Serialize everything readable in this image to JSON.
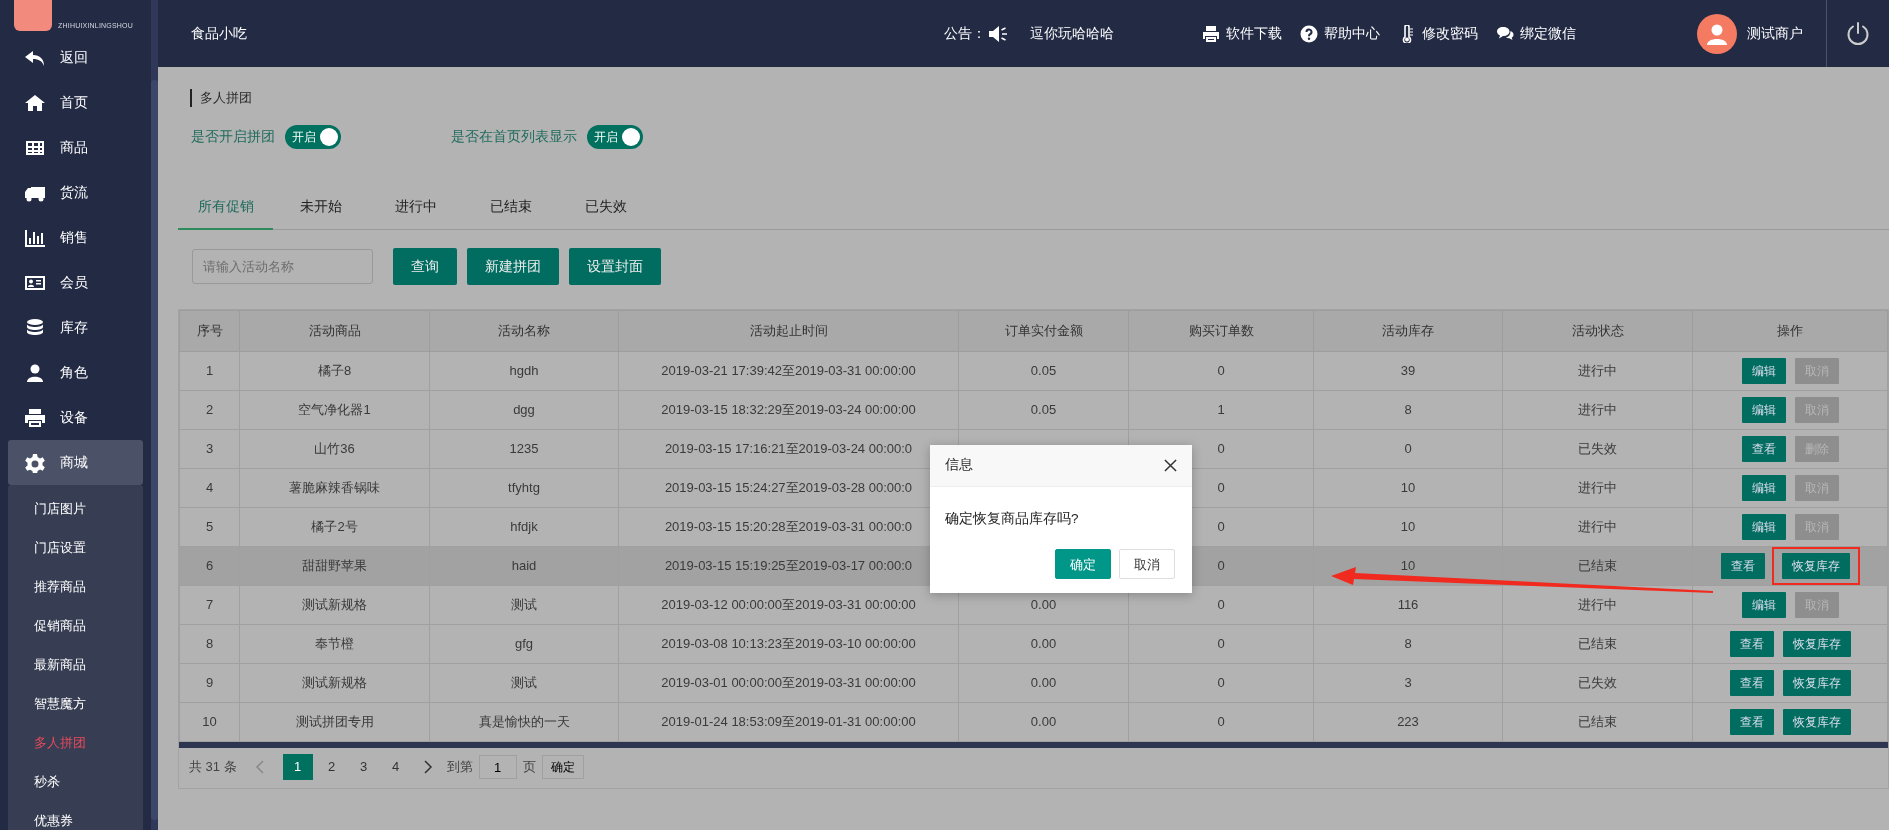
{
  "header": {
    "shop_name": "食品小吃",
    "notice_label": "公告：",
    "notice_text": "逗你玩哈哈哈",
    "links": [
      "软件下载",
      "帮助中心",
      "修改密码",
      "绑定微信"
    ],
    "user_name": "测试商户"
  },
  "sidebar": {
    "logo_text": "ZHIHUIXINLINGSHOU",
    "items": [
      {
        "label": "返回",
        "selected": false
      },
      {
        "label": "首页",
        "selected": false
      },
      {
        "label": "商品",
        "selected": false
      },
      {
        "label": "货流",
        "selected": false
      },
      {
        "label": "销售",
        "selected": false
      },
      {
        "label": "会员",
        "selected": false
      },
      {
        "label": "库存",
        "selected": false
      },
      {
        "label": "角色",
        "selected": false
      },
      {
        "label": "设备",
        "selected": false
      },
      {
        "label": "商城",
        "selected": true,
        "expanded": true,
        "children": [
          {
            "label": "门店图片",
            "selected": false
          },
          {
            "label": "门店设置",
            "selected": false
          },
          {
            "label": "推荐商品",
            "selected": false
          },
          {
            "label": "促销商品",
            "selected": false
          },
          {
            "label": "最新商品",
            "selected": false
          },
          {
            "label": "智慧魔方",
            "selected": false
          },
          {
            "label": "多人拼团",
            "selected": true
          },
          {
            "label": "秒杀",
            "selected": false
          },
          {
            "label": "优惠券",
            "selected": false
          }
        ]
      }
    ]
  },
  "page_title": "多人拼团",
  "toggles": [
    {
      "label": "是否开启拼团",
      "on": true,
      "state_text": "开启"
    },
    {
      "label": "是否在首页列表显示",
      "on": true,
      "state_text": "开启"
    }
  ],
  "tabs": [
    {
      "label": "所有促销",
      "selected": true
    },
    {
      "label": "未开始",
      "selected": false
    },
    {
      "label": "进行中",
      "selected": false
    },
    {
      "label": "已结束",
      "selected": false
    },
    {
      "label": "已失效",
      "selected": false
    }
  ],
  "search": {
    "placeholder": "请输入活动名称"
  },
  "buttons": [
    "查询",
    "新建拼团",
    "设置封面"
  ],
  "table": {
    "columns": [
      "序号",
      "活动商品",
      "活动名称",
      "活动起止时间",
      "订单实付金额",
      "购买订单数",
      "活动库存",
      "活动状态",
      "操作"
    ],
    "rows": [
      {
        "hovered": false,
        "cells": [
          "1",
          "橘子8",
          "hgdh",
          "2019-03-21 17:39:42至2019-03-31 00:00:00",
          "0.05",
          "0",
          "39",
          "进行中"
        ],
        "actions": [
          {
            "label": "编辑",
            "disabled": false
          },
          {
            "label": "取消",
            "disabled": true
          }
        ]
      },
      {
        "hovered": false,
        "cells": [
          "2",
          "空气净化器1",
          "dgg",
          "2019-03-15 18:32:29至2019-03-24 00:00:00",
          "0.05",
          "1",
          "8",
          "进行中"
        ],
        "actions": [
          {
            "label": "编辑",
            "disabled": false
          },
          {
            "label": "取消",
            "disabled": true
          }
        ]
      },
      {
        "hovered": false,
        "cells": [
          "3",
          "山竹36",
          "1235",
          "2019-03-15 17:16:21至2019-03-24 00:00:0",
          null,
          "0",
          "0",
          "已失效"
        ],
        "actions": [
          {
            "label": "查看",
            "disabled": false
          },
          {
            "label": "删除",
            "disabled": true
          }
        ]
      },
      {
        "hovered": false,
        "cells": [
          "4",
          "薯脆麻辣香锅味",
          "tfyhtg",
          "2019-03-15 15:24:27至2019-03-28 00:00:0",
          null,
          "0",
          "10",
          "进行中"
        ],
        "actions": [
          {
            "label": "编辑",
            "disabled": false
          },
          {
            "label": "取消",
            "disabled": true
          }
        ]
      },
      {
        "hovered": false,
        "cells": [
          "5",
          "橘子2号",
          "hfdjk",
          "2019-03-15 15:20:28至2019-03-31 00:00:0",
          null,
          "0",
          "10",
          "进行中"
        ],
        "actions": [
          {
            "label": "编辑",
            "disabled": false
          },
          {
            "label": "取消",
            "disabled": true
          }
        ]
      },
      {
        "hovered": true,
        "cells": [
          "6",
          "甜甜野苹果",
          "haid",
          "2019-03-15 15:19:25至2019-03-17 00:00:0",
          null,
          "0",
          "10",
          "已结束"
        ],
        "actions": [
          {
            "label": "查看",
            "disabled": false
          },
          {
            "label": "恢复库存",
            "disabled": false,
            "annotated": true
          }
        ]
      },
      {
        "hovered": false,
        "cells": [
          "7",
          "测试新规格",
          "测试",
          "2019-03-12 00:00:00至2019-03-31 00:00:00",
          "0.00",
          "0",
          "116",
          "进行中"
        ],
        "actions": [
          {
            "label": "编辑",
            "disabled": false
          },
          {
            "label": "取消",
            "disabled": true
          }
        ]
      },
      {
        "hovered": false,
        "cells": [
          "8",
          "奉节橙",
          "gfg",
          "2019-03-08 10:13:23至2019-03-10 00:00:00",
          "0.00",
          "0",
          "8",
          "已结束"
        ],
        "actions": [
          {
            "label": "查看",
            "disabled": false
          },
          {
            "label": "恢复库存",
            "disabled": false
          }
        ]
      },
      {
        "hovered": false,
        "cells": [
          "9",
          "测试新规格",
          "测试",
          "2019-03-01 00:00:00至2019-03-31 00:00:00",
          "0.00",
          "0",
          "3",
          "已失效"
        ],
        "actions": [
          {
            "label": "查看",
            "disabled": false
          },
          {
            "label": "恢复库存",
            "disabled": false
          }
        ]
      },
      {
        "hovered": false,
        "cells": [
          "10",
          "测试拼团专用",
          "真是愉快的一天",
          "2019-01-24 18:53:09至2019-01-31 00:00:00",
          "0.00",
          "0",
          "223",
          "已结束"
        ],
        "actions": [
          {
            "label": "查看",
            "disabled": false
          },
          {
            "label": "恢复库存",
            "disabled": false
          }
        ]
      }
    ]
  },
  "pagination": {
    "total": "共 31 条",
    "pages": [
      {
        "label": "1",
        "selected": true
      },
      {
        "label": "2",
        "selected": false
      },
      {
        "label": "3",
        "selected": false
      },
      {
        "label": "4",
        "selected": false
      }
    ],
    "goto_label": "到第",
    "goto_value": "1",
    "page_unit": "页",
    "confirm": "确定"
  },
  "modal": {
    "title": "信息",
    "message": "确定恢复商品库存吗?",
    "buttons": [
      {
        "label": "确定",
        "kind": "primary"
      },
      {
        "label": "取消",
        "kind": "secondary"
      }
    ]
  }
}
